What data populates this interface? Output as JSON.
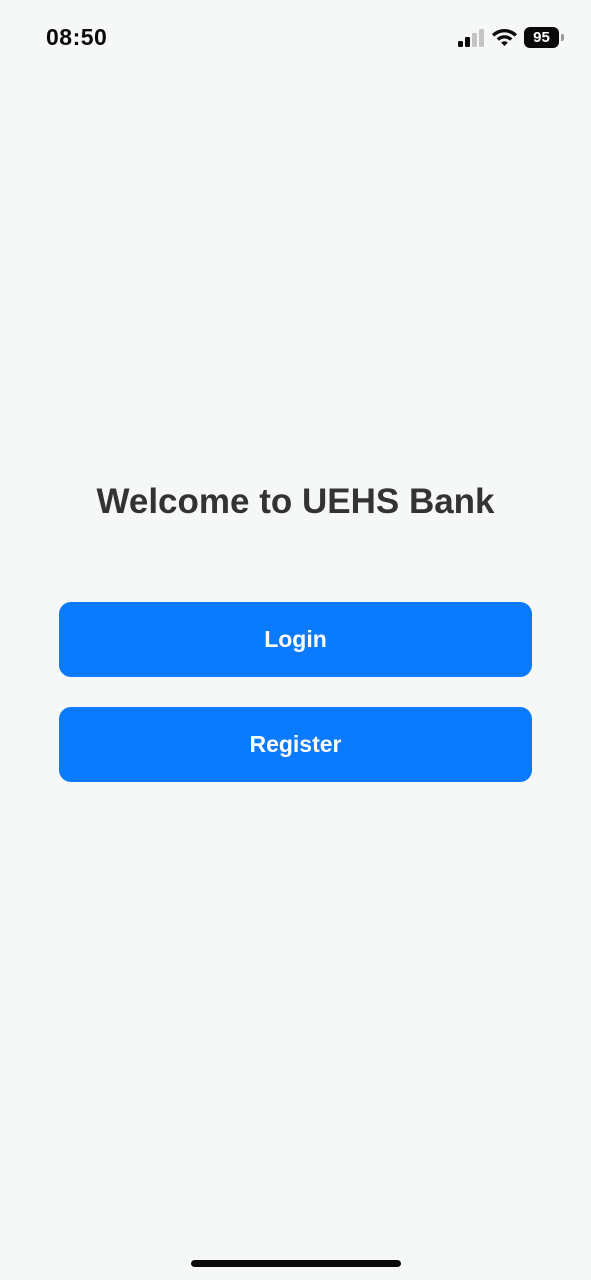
{
  "status_bar": {
    "time": "08:50",
    "battery_level": "95",
    "icons": [
      "signal-icon",
      "wifi-icon",
      "battery-icon"
    ]
  },
  "welcome": {
    "title": "Welcome to UEHS Bank"
  },
  "actions": {
    "login_label": "Login",
    "register_label": "Register"
  },
  "colors": {
    "background": "#f6f8f8",
    "primary": "#0a7bff",
    "title_text": "#333333",
    "button_text": "#ffffff"
  }
}
